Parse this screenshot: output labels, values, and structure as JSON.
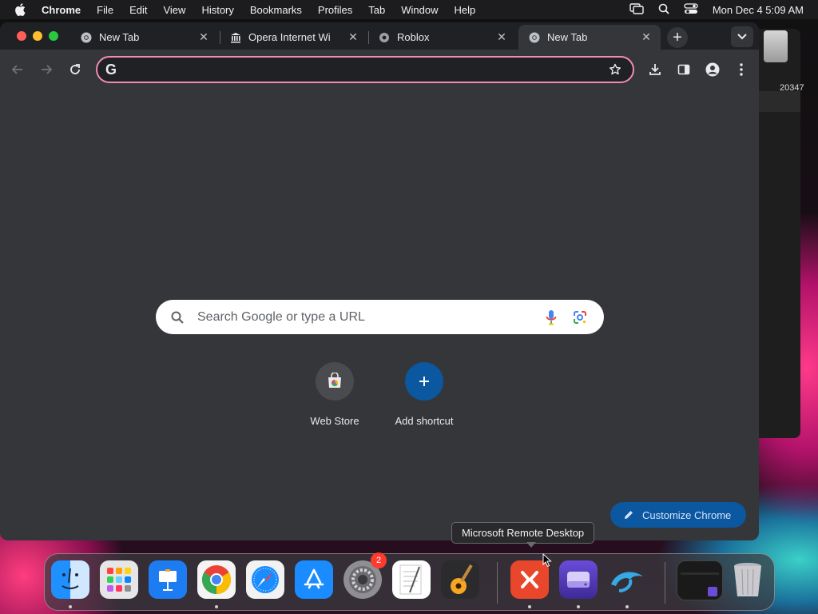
{
  "menubar": {
    "app_name": "Chrome",
    "items": [
      "File",
      "Edit",
      "View",
      "History",
      "Bookmarks",
      "Profiles",
      "Tab",
      "Window",
      "Help"
    ],
    "clock": "Mon Dec 4  5:09 AM"
  },
  "background_window": {
    "partial_text": "20347"
  },
  "tabs": [
    {
      "title": "New Tab",
      "icon": "chrome-icon",
      "active": false
    },
    {
      "title": "Opera Internet Wi",
      "icon": "museum-icon",
      "active": false
    },
    {
      "title": "Roblox",
      "icon": "roblox-icon",
      "active": false
    },
    {
      "title": "New Tab",
      "icon": "chrome-icon",
      "active": true
    }
  ],
  "omnibox": {
    "value": "",
    "prefix": "G"
  },
  "ntp": {
    "search_placeholder": "Search Google or type a URL",
    "shortcuts": [
      {
        "label": "Web Store",
        "icon": "webstore-icon"
      },
      {
        "label": "Add shortcut",
        "icon": "plus-icon"
      }
    ],
    "customize_label": "Customize Chrome"
  },
  "tooltip": {
    "text": "Microsoft Remote Desktop"
  },
  "dock": {
    "apps": [
      {
        "name": "Finder",
        "icon": "finder-icon",
        "running": true
      },
      {
        "name": "Launchpad",
        "icon": "launchpad-icon",
        "running": false
      },
      {
        "name": "Keynote",
        "icon": "keynote-icon",
        "running": false
      },
      {
        "name": "Google Chrome",
        "icon": "chrome-icon",
        "running": true
      },
      {
        "name": "Safari",
        "icon": "safari-icon",
        "running": false
      },
      {
        "name": "App Store",
        "icon": "appstore-icon",
        "running": false
      },
      {
        "name": "System Settings",
        "icon": "settings-icon",
        "running": false,
        "badge": "2"
      },
      {
        "name": "TextEdit",
        "icon": "textedit-icon",
        "running": false
      },
      {
        "name": "GarageBand",
        "icon": "garageband-icon",
        "running": false
      },
      {
        "name": "Microsoft Remote Desktop",
        "icon": "remote-desktop-icon",
        "running": true
      },
      {
        "name": "Disk Utility",
        "icon": "disk-utility-icon",
        "running": true
      },
      {
        "name": "Dolphin",
        "icon": "dolphin-icon",
        "running": true
      },
      {
        "name": "Recent Window",
        "icon": "window-thumbnail-icon",
        "running": false
      },
      {
        "name": "Trash",
        "icon": "trash-icon",
        "running": false
      }
    ]
  }
}
